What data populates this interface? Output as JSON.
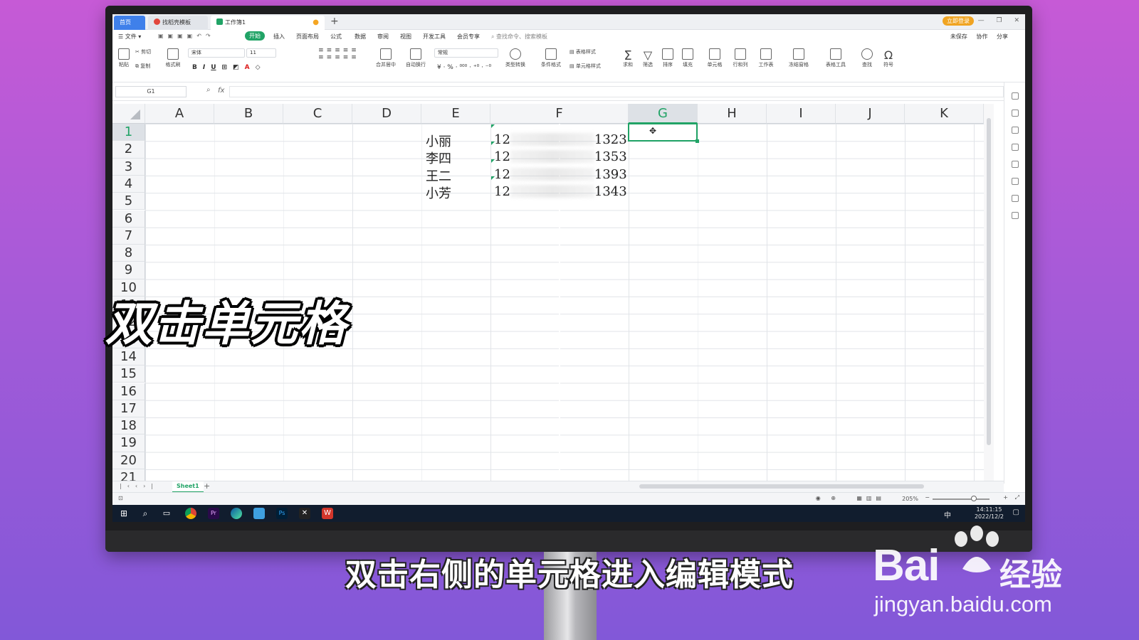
{
  "window": {
    "tabs": [
      {
        "label": "首页"
      },
      {
        "label": "找稻壳模板"
      },
      {
        "label": "工作簿1"
      }
    ],
    "login_button": "立即登录"
  },
  "menu": {
    "items": [
      "文件",
      "开始",
      "插入",
      "页面布局",
      "公式",
      "数据",
      "审阅",
      "视图",
      "开发工具",
      "会员专享"
    ],
    "active": "开始",
    "search_placeholder": "查找命令、搜索模板",
    "right_items": [
      "未保存",
      "协作",
      "分享"
    ]
  },
  "ribbon": {
    "paste": "粘贴",
    "cut": "剪切",
    "copy": "复制",
    "format_painter": "格式刷",
    "font_name": "宋体",
    "font_size": "11",
    "merge": "合并居中",
    "wrap": "自动换行",
    "number_format": "常规",
    "type_convert": "类型转换",
    "cond_format": "条件格式",
    "table_style": "表格样式",
    "cell_style": "单元格样式",
    "sum": "求和",
    "filter": "筛选",
    "sort": "排序",
    "fill": "填充",
    "cell": "单元格",
    "row_col": "行和列",
    "worksheet": "工作表",
    "freeze": "冻结窗格",
    "table_tools": "表格工具",
    "find": "查找",
    "symbol": "符号"
  },
  "formula_bar": {
    "name_box": "G1",
    "fx": "fx",
    "formula": ""
  },
  "grid": {
    "columns": [
      "A",
      "B",
      "C",
      "D",
      "E",
      "F",
      "G",
      "H",
      "I",
      "J",
      "K"
    ],
    "selected_column": "G",
    "rows": [
      "1",
      "2",
      "3",
      "4",
      "5",
      "6",
      "7",
      "8",
      "9",
      "10",
      "11",
      "12",
      "13",
      "14",
      "15",
      "16",
      "17",
      "18",
      "19",
      "20",
      "21"
    ],
    "selected_row": "1",
    "names": [
      "小丽",
      "李四",
      "王二",
      "小芳"
    ],
    "numbers_prefix": [
      "12",
      "12",
      "12",
      "12"
    ],
    "numbers_suffix": [
      "1323",
      "1353",
      "1393",
      "1343"
    ],
    "active_cell": "G1"
  },
  "sheets": {
    "tabs": [
      "Sheet1"
    ],
    "add": "+"
  },
  "status": {
    "zoom": "205%"
  },
  "taskbar": {
    "ime": "中",
    "time": "14:11:15",
    "date": "2022/12/2"
  },
  "overlay": {
    "heading": "双击单元格",
    "subtitle": "双击右侧的单元格进入编辑模式"
  },
  "watermark": {
    "brand": "Bai",
    "brand2": "经验",
    "url": "jingyan.baidu.com"
  },
  "colors": {
    "accent": "#21a366",
    "tab_home": "#3f80ea",
    "background": "#b05ad8"
  }
}
